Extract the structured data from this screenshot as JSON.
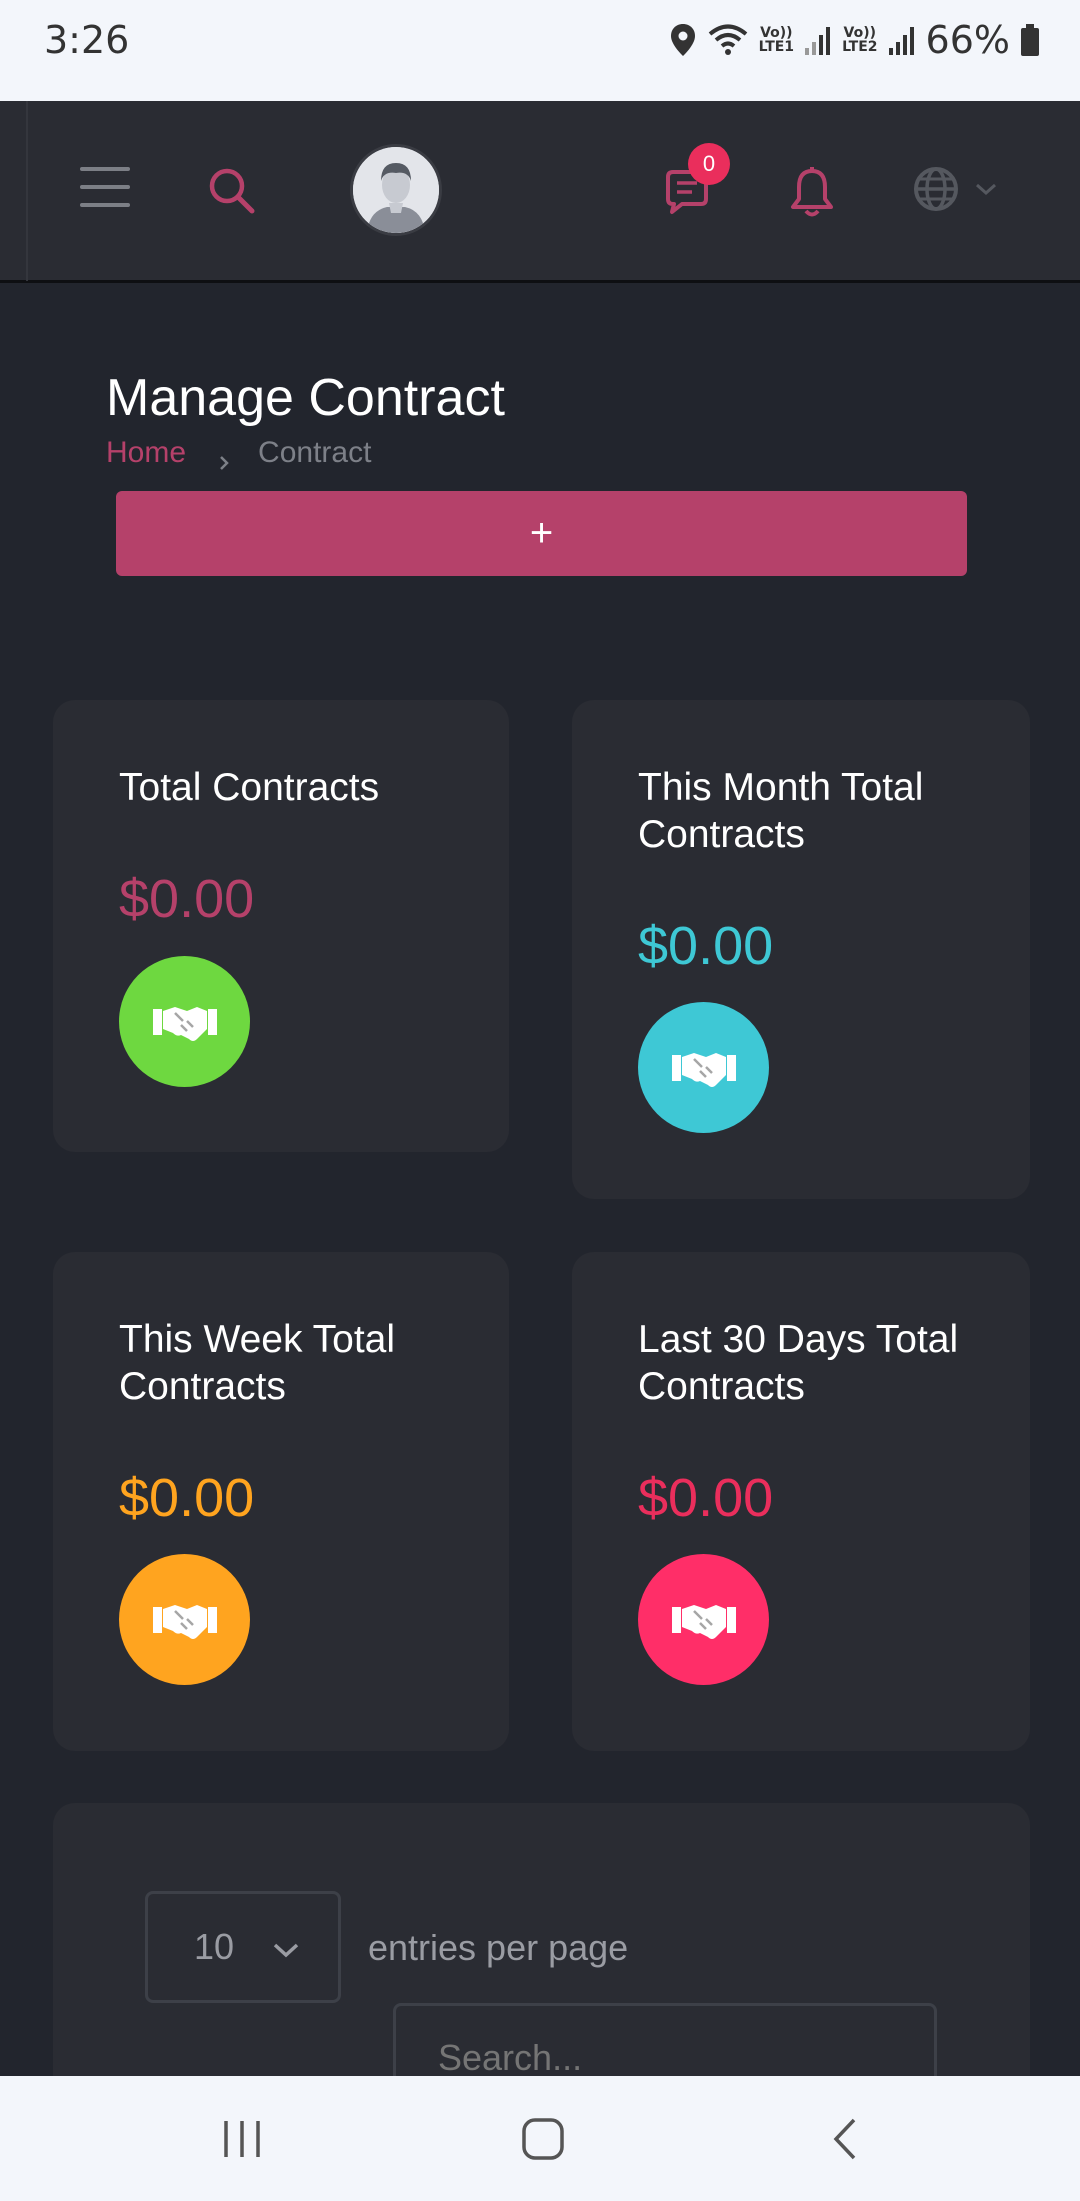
{
  "status_bar": {
    "time": "3:26",
    "sim1": [
      "Vo))",
      "LTE1"
    ],
    "sim2": [
      "Vo))",
      "LTE2"
    ],
    "battery": "66%"
  },
  "header": {
    "message_count": "0",
    "icons": [
      "menu-icon",
      "search-icon",
      "avatar",
      "chat-icon",
      "bell-icon",
      "globe-icon",
      "chevron-down-icon"
    ]
  },
  "page": {
    "title": "Manage Contract",
    "breadcrumb": {
      "home": "Home",
      "current": "Contract"
    },
    "add_button": "+"
  },
  "cards": [
    {
      "title": "Total Contracts",
      "value": "$0.00",
      "value_color": "#b5416a",
      "icon_color": "#6ed840",
      "icon": "handshake-icon"
    },
    {
      "title": "This Month Total Contracts",
      "value": "$0.00",
      "value_color": "#3ec8d5",
      "icon_color": "#3ec8d5",
      "icon": "handshake-icon"
    },
    {
      "title": "This Week Total Contracts",
      "value": "$0.00",
      "value_color": "#ffa41f",
      "icon_color": "#ffa41f",
      "icon": "handshake-icon"
    },
    {
      "title": "Last 30 Days Total Contracts",
      "value": "$0.00",
      "value_color": "#ea2e5c",
      "icon_color": "#ff2e68",
      "icon": "handshake-icon"
    }
  ],
  "table": {
    "entries_value": "10",
    "entries_label": "entries per page",
    "search_placeholder": "Search..."
  },
  "colors": {
    "background": "#22252d",
    "panel": "#2a2c33",
    "accent": "#b5416a"
  }
}
